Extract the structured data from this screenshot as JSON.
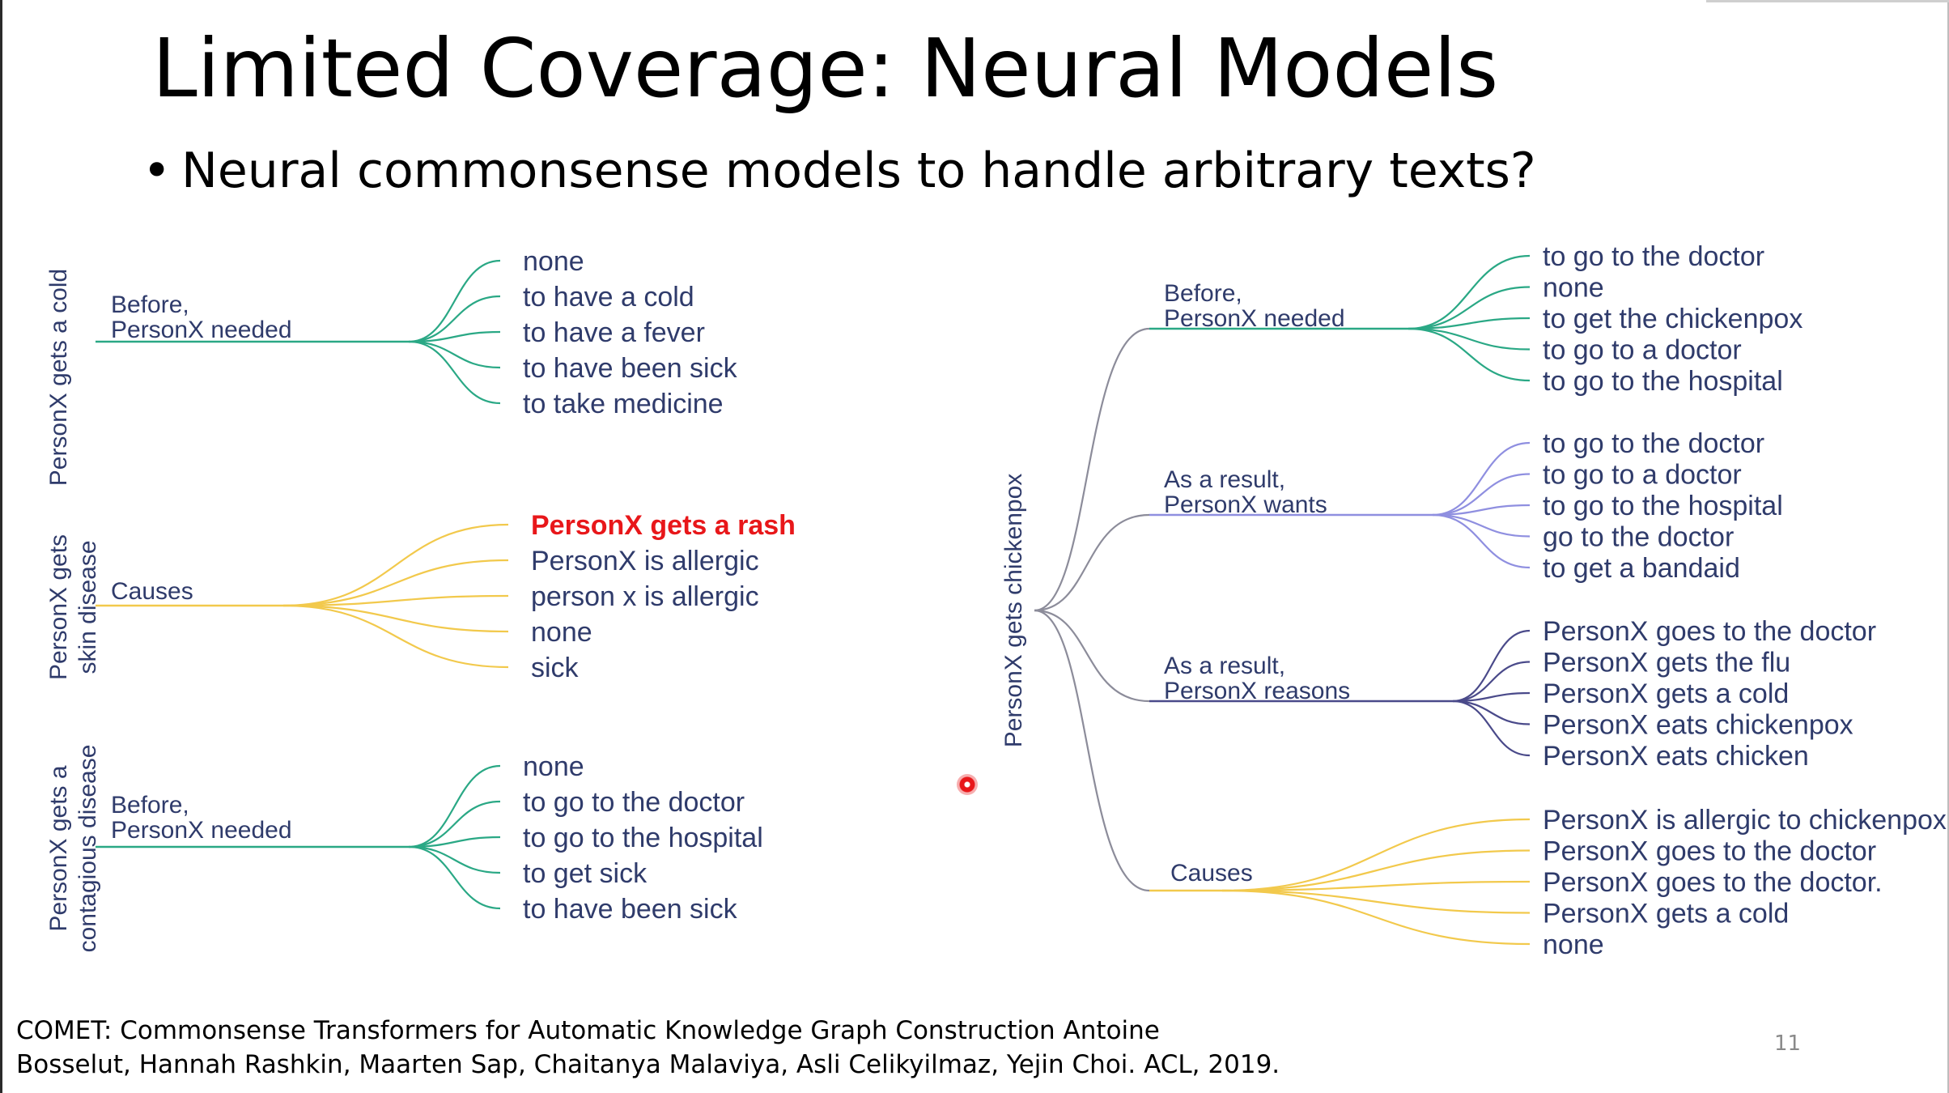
{
  "slide": {
    "title": "Limited Coverage: Neural Models",
    "bullet": "Neural commonsense models to handle arbitrary texts?",
    "citation_line1": "COMET: Commonsense Transformers for Automatic Knowledge Graph Construction Antoine",
    "citation_line2": "Bosselut, Hannah Rashkin, Maarten Sap, Chaitanya Malaviya, Asli Celikyilmaz, Yejin Choi. ACL, 2019.",
    "page_number": "11"
  },
  "colors": {
    "green": "#2aa885",
    "yellow": "#f2c94c",
    "purple": "#8f8fe0",
    "navy": "#4a4a8a",
    "gray": "#8c8c9a",
    "text": "#2f3b6b",
    "highlight": "#e8171a"
  },
  "left_trees": [
    {
      "root": [
        "PersonX gets a cold"
      ],
      "relation": [
        "Before,",
        "PersonX needed"
      ],
      "color": "green",
      "leaves": [
        {
          "text": "none"
        },
        {
          "text": "to have a cold"
        },
        {
          "text": "to have a fever"
        },
        {
          "text": "to have been sick"
        },
        {
          "text": "to take medicine"
        }
      ]
    },
    {
      "root": [
        "PersonX gets",
        "skin disease"
      ],
      "relation": [
        "Causes"
      ],
      "color": "yellow",
      "leaves": [
        {
          "text": "PersonX gets a rash",
          "highlight": true
        },
        {
          "text": "PersonX is allergic"
        },
        {
          "text": "person x is allergic"
        },
        {
          "text": "none"
        },
        {
          "text": "sick"
        }
      ]
    },
    {
      "root": [
        "PersonX gets a",
        "contagious disease"
      ],
      "relation": [
        "Before,",
        "PersonX needed"
      ],
      "color": "green",
      "leaves": [
        {
          "text": "none"
        },
        {
          "text": "to go to the doctor"
        },
        {
          "text": "to go to the hospital"
        },
        {
          "text": "to get sick"
        },
        {
          "text": "to have been sick"
        }
      ]
    }
  ],
  "right_tree": {
    "root": "PersonX gets chickenpox",
    "branches": [
      {
        "relation": [
          "Before,",
          "PersonX needed"
        ],
        "color": "green",
        "leaves": [
          "to go to the doctor",
          "none",
          "to get the chickenpox",
          "to go to a doctor",
          "to go to the hospital"
        ]
      },
      {
        "relation": [
          "As a result,",
          "PersonX wants"
        ],
        "color": "purple",
        "leaves": [
          "to go to the doctor",
          "to go to a doctor",
          "to go to the hospital",
          "go to the doctor",
          "to get a bandaid"
        ]
      },
      {
        "relation": [
          "As a result,",
          "PersonX reasons"
        ],
        "color": "navy",
        "leaves": [
          "PersonX goes to the doctor",
          "PersonX gets the flu",
          "PersonX gets a cold",
          "PersonX eats chickenpox",
          "PersonX eats chicken"
        ]
      },
      {
        "relation": [
          "Causes"
        ],
        "color": "yellow",
        "leaves": [
          "PersonX is allergic to chickenpox",
          "PersonX goes to the doctor",
          "PersonX goes to the doctor.",
          "PersonX gets a cold",
          "none"
        ]
      }
    ]
  }
}
